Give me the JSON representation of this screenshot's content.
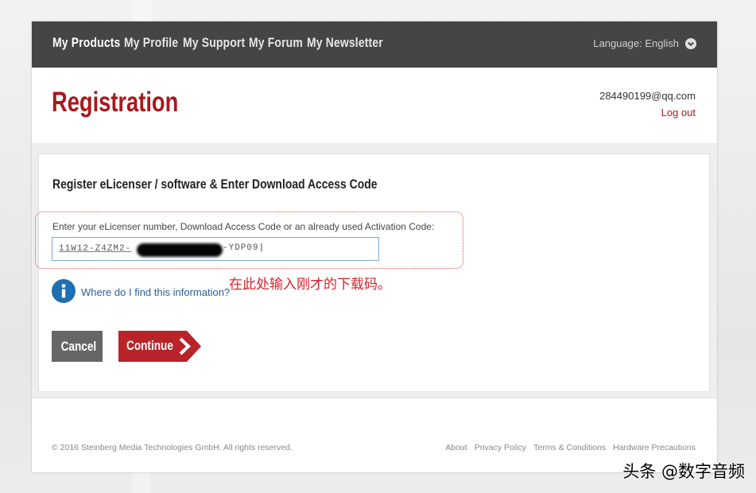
{
  "nav": {
    "items": [
      "My Products",
      "My Profile",
      "My Support",
      "My Forum",
      "My Newsletter"
    ],
    "language_label": "Language: English"
  },
  "header": {
    "title": "Registration",
    "email": "284490199@qq.com",
    "logout": "Log out"
  },
  "card": {
    "title": "Register eLicenser / software & Enter Download Access Code",
    "field_label": "Enter your eLicenser number, Download Access Code or an already used Activation Code:",
    "code_value_start": "11W12-Z4ZM2-",
    "code_value_end": "-YDP09",
    "info_link": "Where do I find this information?",
    "annotation": "在此处输入刚才的下载码。",
    "cancel_label": "Cancel",
    "continue_label": "Continue"
  },
  "footer": {
    "copyright": "© 2016 Steinberg Media Technologies GmbH. All rights reserved.",
    "links": [
      "About",
      "Privacy Policy",
      "Terms & Conditions",
      "Hardware Precautions"
    ]
  },
  "watermark": "头条 @数字音频",
  "colors": {
    "brand_red": "#a8191d",
    "nav_bg": "#454545",
    "link_blue": "#2a5f9e",
    "info_blue": "#1f6fb3"
  }
}
